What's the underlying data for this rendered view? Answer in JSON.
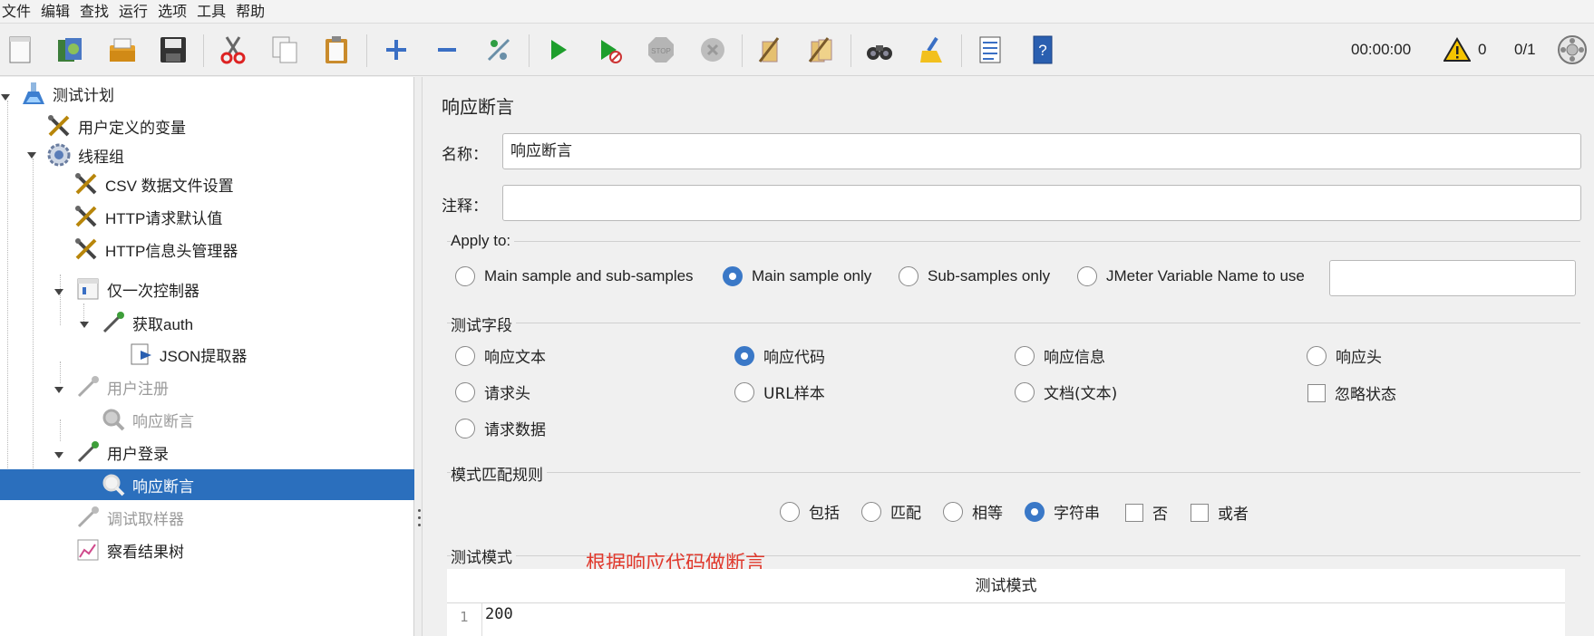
{
  "menu": [
    "文件",
    "编辑",
    "查找",
    "运行",
    "选项",
    "工具",
    "帮助"
  ],
  "toolbar_icons": [
    "new-icon",
    "templates-icon",
    "open-icon",
    "save-icon",
    "cut-icon",
    "copy-icon",
    "paste-icon",
    "expand-icon",
    "collapse-icon",
    "toggle-icon",
    "start-icon",
    "start-no-pause-icon",
    "stop-icon",
    "shutdown-icon",
    "clear-icon",
    "clear-all-icon",
    "search-icon",
    "reset-search-icon",
    "function-helper-icon",
    "help-icon"
  ],
  "status": {
    "timer": "00:00:00",
    "warnings": "0",
    "threads": "0/1"
  },
  "tree": {
    "n0": "测试计划",
    "n1": "用户定义的变量",
    "n2": "线程组",
    "n3": "CSV 数据文件设置",
    "n4": "HTTP请求默认值",
    "n5": "HTTP信息头管理器",
    "n6": "仅一次控制器",
    "n7": "获取auth",
    "n8": "JSON提取器",
    "n9": "用户注册",
    "n10": "响应断言",
    "n11": "用户登录",
    "n12": "响应断言",
    "n13": "调试取样器",
    "n14": "察看结果树"
  },
  "panel": {
    "title": "响应断言",
    "name_label": "名称：",
    "name_value": "响应断言",
    "comment_label": "注释：",
    "comment_value": "",
    "apply_to": {
      "title": "Apply to:",
      "opt1": "Main sample and sub-samples",
      "opt2": "Main sample only",
      "opt3": "Sub-samples only",
      "opt4": "JMeter Variable Name to use",
      "selected": "Main sample only",
      "var_value": ""
    },
    "field": {
      "title": "测试字段",
      "o1": "响应文本",
      "o2": "响应代码",
      "o3": "响应信息",
      "o4": "响应头",
      "o5": "请求头",
      "o6": "URL样本",
      "o7": "文档(文本)",
      "o8": "忽略状态",
      "o9": "请求数据",
      "selected": "响应代码"
    },
    "rule": {
      "title": "模式匹配规则",
      "o1": "包括",
      "o2": "匹配",
      "o3": "相等",
      "o4": "字符串",
      "o5": "否",
      "o6": "或者",
      "selected": "字符串"
    },
    "pattern": {
      "title": "测试模式",
      "annotation": "根据响应代码做断言",
      "column": "测试模式",
      "line_no": "1",
      "line_value": "200"
    }
  }
}
